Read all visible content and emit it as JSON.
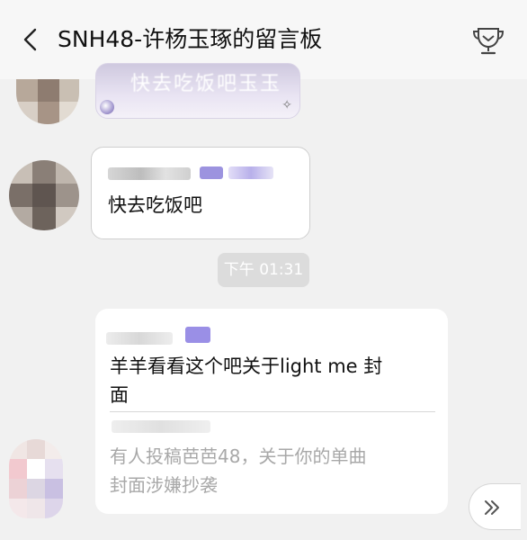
{
  "header": {
    "title": "SNH48-许杨玉琢的留言板",
    "back_icon": "chevron-left-icon",
    "right_icon": "trophy-icon"
  },
  "messages": [
    {
      "type": "cut-off-image-bubble",
      "text": "快去吃饭吧玉玉"
    },
    {
      "type": "text",
      "text": "快去吃饭吧"
    },
    {
      "type": "time",
      "text": "下午 01:31"
    },
    {
      "type": "reply",
      "line1": "羊羊看看这个吧关于light me 封",
      "line2": "面",
      "quote_line1": "有人投稿芭芭48，关于你的单曲",
      "quote_line2": "封面涉嫌抄袭"
    }
  ],
  "scroll_button": {
    "icon": "double-chevron-right-icon"
  },
  "colors": {
    "background": "#f1f1f1",
    "header": "#f7f7f7",
    "bubble": "#ffffff",
    "quote_text": "#a8a8a8",
    "pixel_accent": "#8c7fe0"
  }
}
